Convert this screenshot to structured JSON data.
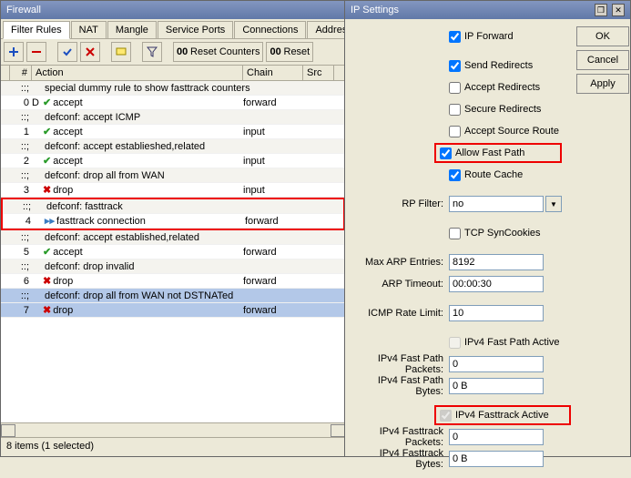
{
  "firewall": {
    "title": "Firewall",
    "tabs": [
      "Filter Rules",
      "NAT",
      "Mangle",
      "Service Ports",
      "Connections",
      "Address Li"
    ],
    "toolbar": {
      "reset_counters": "Reset Counters",
      "reset": "Reset"
    },
    "columns": {
      "num": "#",
      "action": "Action",
      "chain": "Chain",
      "src": "Src"
    },
    "rows": [
      {
        "type": "comment",
        "text": "special dummy rule to show fasttrack counters"
      },
      {
        "type": "rule",
        "num": "0",
        "flag": "D",
        "icon": "accept",
        "action": "accept",
        "chain": "forward"
      },
      {
        "type": "comment",
        "text": "defconf: accept ICMP"
      },
      {
        "type": "rule",
        "num": "1",
        "flag": "",
        "icon": "accept",
        "action": "accept",
        "chain": "input"
      },
      {
        "type": "comment",
        "text": "defconf: accept establieshed,related"
      },
      {
        "type": "rule",
        "num": "2",
        "flag": "",
        "icon": "accept",
        "action": "accept",
        "chain": "input"
      },
      {
        "type": "comment",
        "text": "defconf: drop all from WAN"
      },
      {
        "type": "rule",
        "num": "3",
        "flag": "",
        "icon": "drop",
        "action": "drop",
        "chain": "input"
      },
      {
        "type": "comment",
        "text": "defconf: fasttrack",
        "highlight": true
      },
      {
        "type": "rule",
        "num": "4",
        "flag": "",
        "icon": "fasttrack",
        "action": "fasttrack connection",
        "chain": "forward",
        "highlight": true
      },
      {
        "type": "comment",
        "text": "defconf: accept established,related"
      },
      {
        "type": "rule",
        "num": "5",
        "flag": "",
        "icon": "accept",
        "action": "accept",
        "chain": "forward"
      },
      {
        "type": "comment",
        "text": "defconf: drop invalid"
      },
      {
        "type": "rule",
        "num": "6",
        "flag": "",
        "icon": "drop",
        "action": "drop",
        "chain": "forward"
      },
      {
        "type": "comment",
        "text": "defconf:  drop all from WAN not DSTNATed",
        "selected": true
      },
      {
        "type": "rule",
        "num": "7",
        "flag": "",
        "icon": "drop",
        "action": "drop",
        "chain": "forward",
        "selected": true
      }
    ],
    "status": "8 items (1 selected)"
  },
  "ip": {
    "title": "IP Settings",
    "buttons": {
      "ok": "OK",
      "cancel": "Cancel",
      "apply": "Apply"
    },
    "checks": {
      "ip_forward": "IP Forward",
      "send_redirects": "Send Redirects",
      "accept_redirects": "Accept Redirects",
      "secure_redirects": "Secure Redirects",
      "accept_source_route": "Accept Source Route",
      "allow_fast_path": "Allow Fast Path",
      "route_cache": "Route Cache",
      "tcp_syncookies": "TCP SynCookies",
      "ipv4_fast_path_active": "IPv4 Fast Path Active",
      "ipv4_fasttrack_active": "IPv4 Fasttrack Active"
    },
    "labels": {
      "rp_filter": "RP Filter:",
      "max_arp": "Max ARP Entries:",
      "arp_timeout": "ARP Timeout:",
      "icmp_rate": "ICMP Rate Limit:",
      "fp_packets": "IPv4 Fast Path Packets:",
      "fp_bytes": "IPv4 Fast Path Bytes:",
      "ft_packets": "IPv4 Fasttrack Packets:",
      "ft_bytes": "IPv4 Fasttrack Bytes:"
    },
    "values": {
      "rp_filter": "no",
      "max_arp": "8192",
      "arp_timeout": "00:00:30",
      "icmp_rate": "10",
      "fp_packets": "0",
      "fp_bytes": "0 B",
      "ft_packets": "0",
      "ft_bytes": "0 B"
    },
    "checked": {
      "ip_forward": true,
      "send_redirects": true,
      "accept_redirects": false,
      "secure_redirects": false,
      "accept_source_route": false,
      "allow_fast_path": true,
      "route_cache": true,
      "tcp_syncookies": false,
      "ipv4_fast_path_active": false,
      "ipv4_fasttrack_active": true
    }
  }
}
